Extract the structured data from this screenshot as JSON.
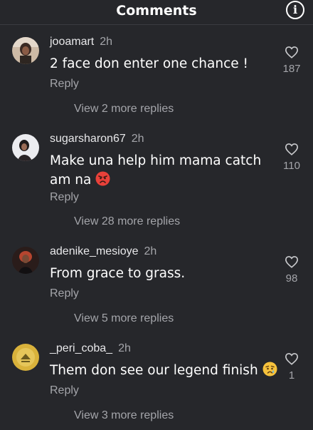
{
  "header": {
    "title": "Comments",
    "info_icon": "info-icon"
  },
  "comments": [
    {
      "username": "jooamart",
      "time": "2h",
      "text": "2 face don enter one chance !",
      "reply_label": "Reply",
      "view_more": "View 2 more replies",
      "likes": "187",
      "avatar_color": "#c9b6a3"
    },
    {
      "username": "sugarsharon67",
      "time": "2h",
      "text": "Make una help him mama catch am na",
      "emoji": "pouting-face",
      "reply_label": "Reply",
      "view_more": "View 28 more replies",
      "likes": "110",
      "avatar_color": "#e6e6ea"
    },
    {
      "username": "adenike_mesioye",
      "time": "2h",
      "text": "From grace to grass.",
      "reply_label": "Reply",
      "view_more": "View 5 more replies",
      "likes": "98",
      "avatar_color": "#3a2722"
    },
    {
      "username": "_peri_coba_",
      "time": "2h",
      "text": "Them don see our legend finish",
      "emoji": "crying-face",
      "reply_label": "Reply",
      "view_more": "View 3 more replies",
      "likes": "1",
      "avatar_color": "#d8b23a"
    }
  ],
  "colors": {
    "background": "#26272b",
    "secondary_text": "#a4a5aa",
    "primary_text": "#ffffff"
  }
}
